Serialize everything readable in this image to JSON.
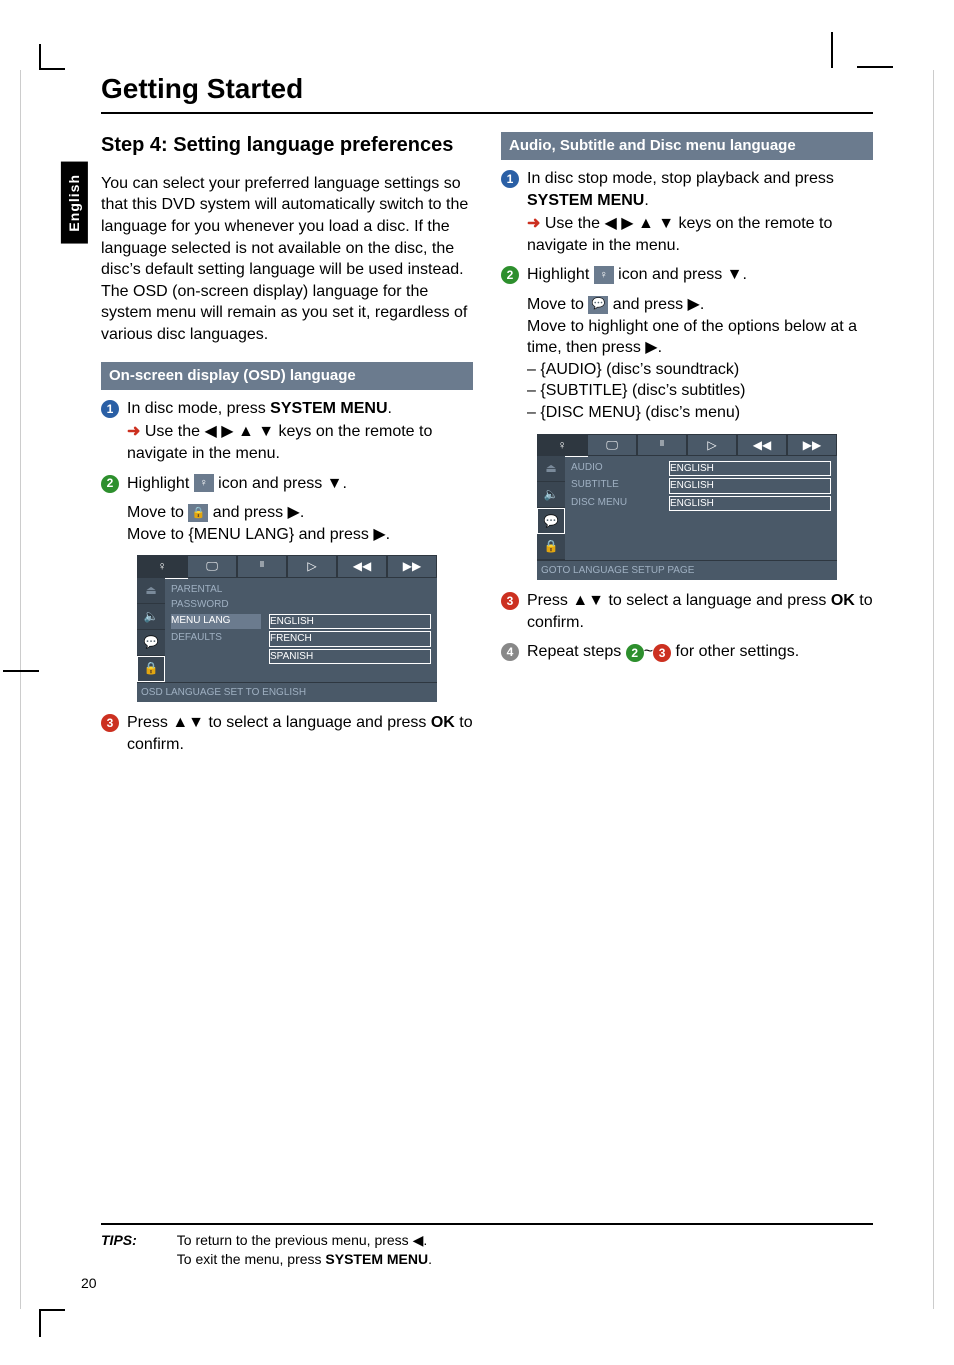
{
  "sideTab": "English",
  "h1": "Getting Started",
  "h2_prefix": "Step 4:  ",
  "h2_rest": "Setting language preferences",
  "intro": "You can select your preferred language settings so that this DVD system will automatically switch to the language for you whenever you load a disc.  If the language selected is not available on the disc, the disc’s default setting language will be used instead.  The OSD (on-screen display) language for the system menu will remain as you set it, regardless of various disc languages.",
  "bandA": "On-screen display (OSD) language",
  "bandB": "Audio, Subtitle and Disc menu language",
  "steps": {
    "a1_a": "In disc mode, press ",
    "a1_b": "SYSTEM MENU",
    "a1_c": ".",
    "a1_sub_a": "Use the ◀ ▶ ▲ ▼ keys on the remote to navigate in the menu.",
    "a2_a": "Highlight ",
    "a2_b": " icon and press ▼.",
    "a2_sub1_a": "Move to ",
    "a2_sub1_b": " and press ▶.",
    "a2_sub2": "Move to {MENU LANG} and press ▶.",
    "a3_a": "Press ▲▼ to select a language and press ",
    "a3_b": "OK",
    "a3_c": " to confirm.",
    "b1_a": "In disc stop mode, stop playback and press ",
    "b1_b": "SYSTEM MENU",
    "b1_c": ".",
    "b1_sub_a": "Use the ◀ ▶ ▲ ▼ keys on the remote to navigate in the menu.",
    "b2_a": "Highlight ",
    "b2_b": " icon and press ▼.",
    "b2_sub1_a": "Move to ",
    "b2_sub1_b": " and press ▶.",
    "b2_sub2": "Move to highlight one of the options below at a time, then press ▶.",
    "b2_list1": "{AUDIO} (disc’s soundtrack)",
    "b2_list2": "{SUBTITLE} (disc’s subtitles)",
    "b2_list3": "{DISC MENU} (disc’s menu)",
    "b3_a": "Press ▲▼ to select a language and press ",
    "b3_b": "OK",
    "b3_c": " to confirm.",
    "b4_a": "Repeat steps ",
    "b4_b": " for other settings.",
    "b4_tilde": "~"
  },
  "iconText": {
    "person": "♀",
    "lock": "🔒",
    "speech": "💬"
  },
  "screenA": {
    "tabs": [
      "♀",
      "🖵",
      "ᴵᴵ",
      "▷",
      "◀◀",
      "▶▶"
    ],
    "selTab": 0,
    "side": [
      "⏏",
      "🔈",
      "💬",
      "🔒"
    ],
    "activeSide": 3,
    "rows": [
      {
        "lab": "PARENTAL",
        "val": ""
      },
      {
        "lab": "PASSWORD",
        "val": ""
      },
      {
        "lab": "MENU LANG",
        "val": "ENGLISH",
        "hl": true
      },
      {
        "lab": "DEFAULTS",
        "val": "FRENCH",
        "opt": true
      },
      {
        "lab": "",
        "val": "SPANISH",
        "opt": true
      }
    ],
    "status": "OSD LANGUAGE SET TO ENGLISH"
  },
  "screenB": {
    "tabs": [
      "♀",
      "🖵",
      "ᴵᴵ",
      "▷",
      "◀◀",
      "▶▶"
    ],
    "selTab": 0,
    "side": [
      "⏏",
      "🔈",
      "💬",
      "🔒"
    ],
    "activeSide": 2,
    "rows": [
      {
        "lab": "AUDIO",
        "val": "ENGLISH",
        "box": true
      },
      {
        "lab": "SUBTITLE",
        "val": "ENGLISH",
        "box": true
      },
      {
        "lab": "DISC MENU",
        "val": "ENGLISH",
        "box": true
      }
    ],
    "status": "GOTO LANGUAGE SETUP PAGE"
  },
  "tips": {
    "label": "TIPS:",
    "line1_a": "To return to the previous menu, press ◀.",
    "line2_a": "To exit the menu, press ",
    "line2_b": "SYSTEM MENU",
    "line2_c": "."
  },
  "pageNum": "20"
}
